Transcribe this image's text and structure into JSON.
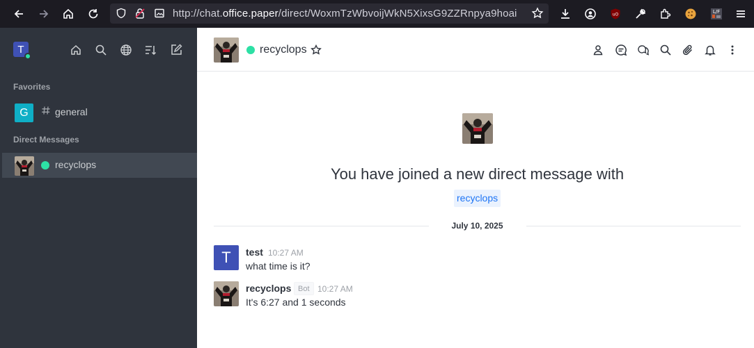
{
  "browser": {
    "url_prefix": "http://chat.",
    "url_host": "office.paper",
    "url_path": "/direct/WoxmTzWbvoijWkN5XixsG9ZZRnpya9hoai"
  },
  "sidebar": {
    "workspace_initial": "T",
    "favorites_title": "Favorites",
    "favorites": [
      {
        "initial": "G",
        "label": "general"
      }
    ],
    "dm_title": "Direct Messages",
    "dms": [
      {
        "label": "recyclops"
      }
    ]
  },
  "header": {
    "name": "recyclops"
  },
  "welcome": {
    "text": "You have joined a new direct message with",
    "user": "recyclops"
  },
  "divider": {
    "date": "July 10, 2025"
  },
  "messages": [
    {
      "user": "test",
      "initial": "T",
      "time": "10:27 AM",
      "text": "what time is it?",
      "bot": ""
    },
    {
      "user": "recyclops",
      "initial": "",
      "time": "10:27 AM",
      "text": "It's 6:27 and 1 seconds",
      "bot": "Bot"
    }
  ],
  "colors": {
    "online": "#2de0a5",
    "sidebar_bg": "#2f343d",
    "accent": "#1d74f5",
    "avatar_blue": "#3f51b5",
    "general_teal": "#0fafc6"
  }
}
